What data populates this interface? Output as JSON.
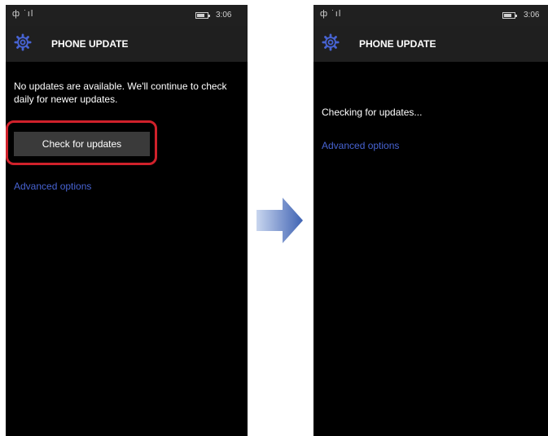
{
  "before": {
    "status": {
      "signal": "ф ˙ıl",
      "time": "3:06"
    },
    "header": {
      "title": "PHONE UPDATE",
      "icon": "gear-icon"
    },
    "message": "No updates are available. We'll continue to check daily for newer updates.",
    "check_button_label": "Check for updates",
    "advanced_link": "Advanced options"
  },
  "after": {
    "status": {
      "signal": "ф ˙ıl",
      "time": "3:06"
    },
    "header": {
      "title": "PHONE UPDATE",
      "icon": "gear-icon"
    },
    "checking_text": "Checking for updates...",
    "advanced_link": "Advanced options"
  },
  "colors": {
    "accent": "#4763d2",
    "highlight": "#d0212b",
    "arrow": "#3f63b3"
  }
}
